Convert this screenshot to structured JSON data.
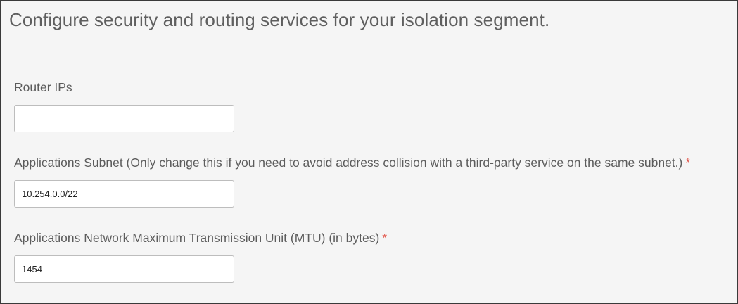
{
  "header": {
    "title": "Configure security and routing services for your isolation segment."
  },
  "fields": {
    "router_ips": {
      "label": "Router IPs",
      "value": "",
      "required_mark": ""
    },
    "applications_subnet": {
      "label": "Applications Subnet (Only change this if you need to avoid address collision with a third-party service on the same subnet.)",
      "value": "10.254.0.0/22",
      "required_mark": "*"
    },
    "mtu": {
      "label": "Applications Network Maximum Transmission Unit (MTU) (in bytes)",
      "value": "1454",
      "required_mark": "*"
    }
  },
  "colors": {
    "required_asterisk": "#e2564b",
    "page_background": "#f5f5f5",
    "input_border": "#bdbdbd"
  }
}
